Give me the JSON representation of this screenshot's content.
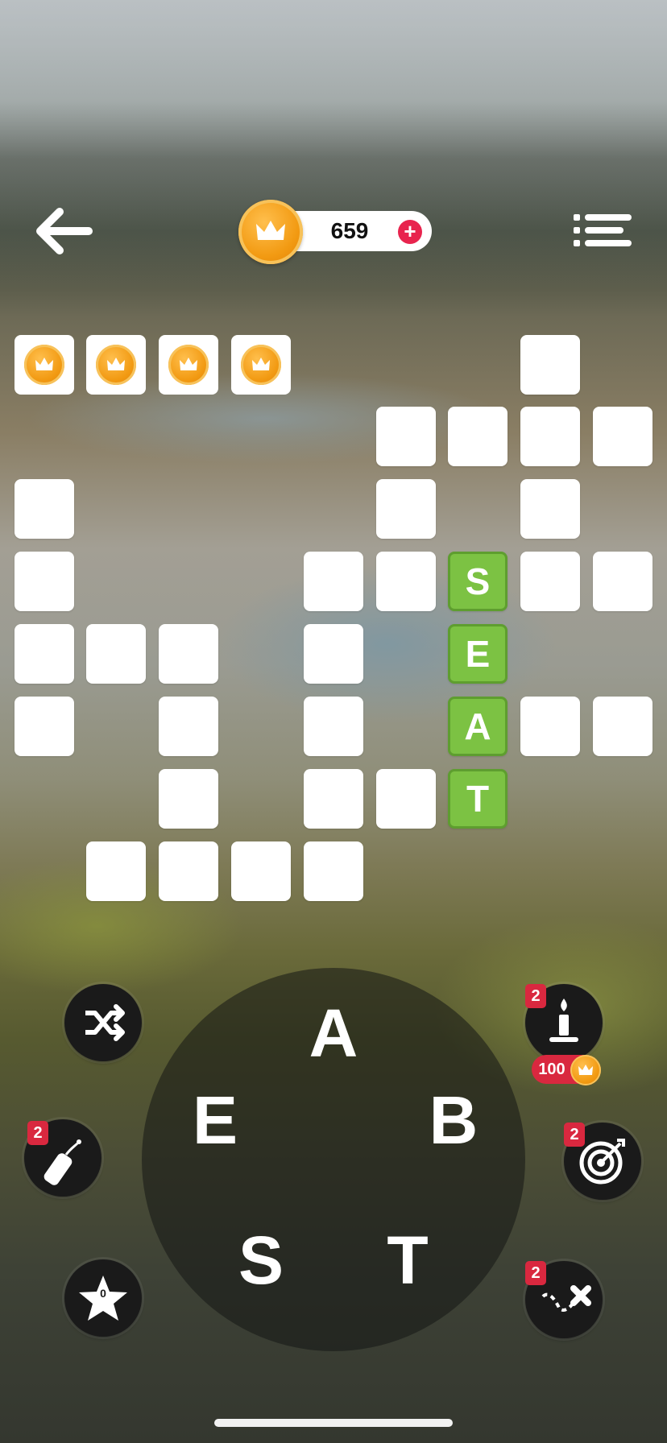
{
  "header": {
    "coins": "659",
    "add_coins_label": "+"
  },
  "bonus_coins": {
    "collected": 4
  },
  "board": {
    "solved_word": [
      "S",
      "E",
      "A",
      "T"
    ]
  },
  "wheel": {
    "letters": [
      "A",
      "B",
      "T",
      "S",
      "E"
    ]
  },
  "tools": {
    "candle_badge": "2",
    "candle_cost": "100",
    "dynamite_badge": "2",
    "target_badge": "2",
    "path_badge": "2",
    "star_count": "0"
  },
  "colors": {
    "solved_cell": "#7cc243",
    "coin": "#f29a12",
    "badge": "#d9283f"
  }
}
